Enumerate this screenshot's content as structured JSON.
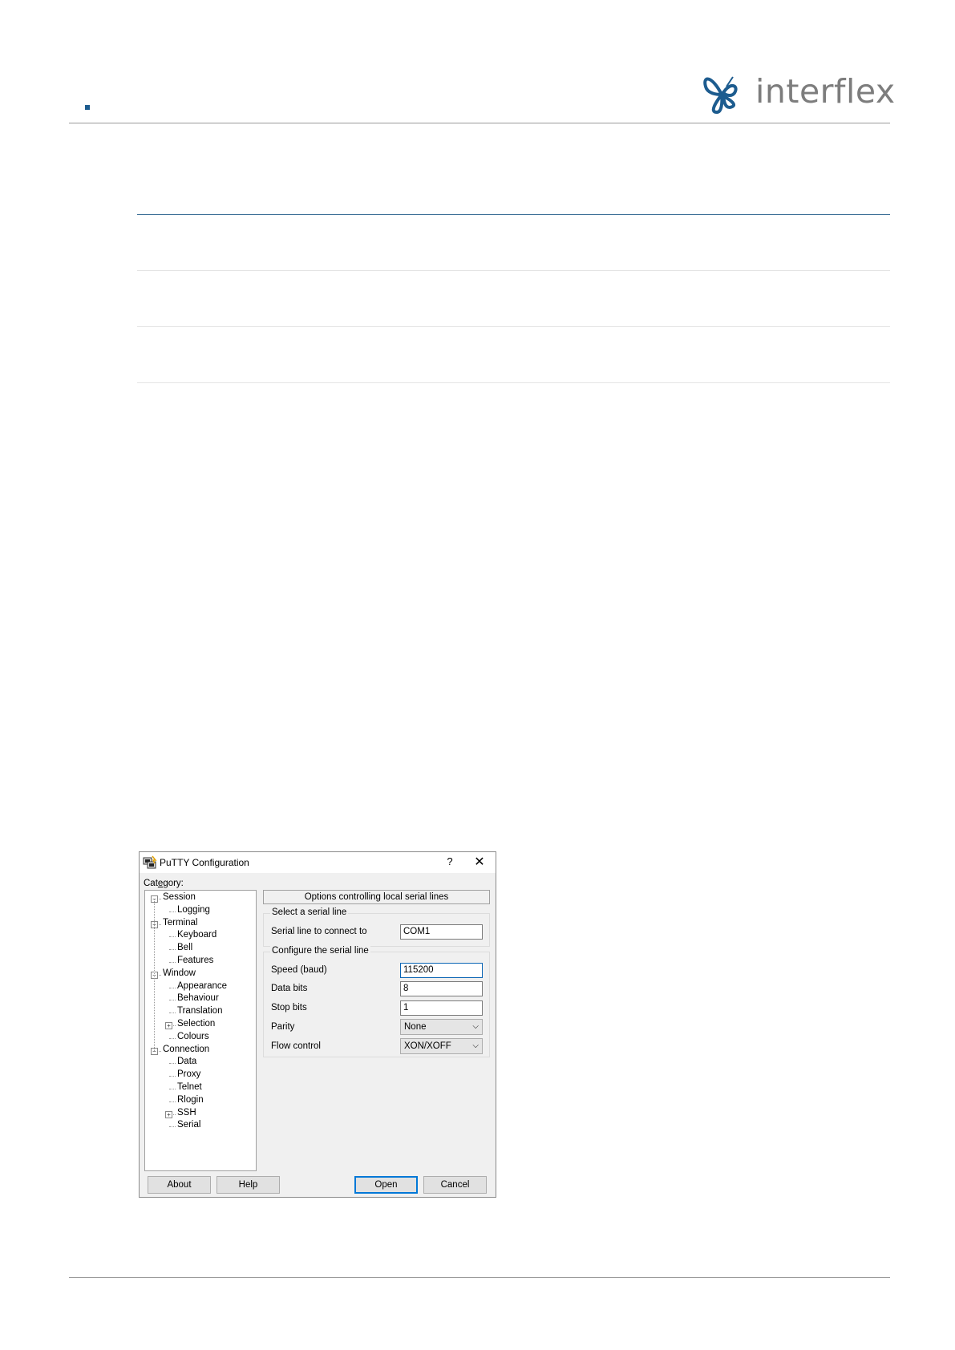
{
  "header": {
    "brand": "interflex"
  },
  "putty": {
    "title": "PuTTY Configuration",
    "help_glyph": "?",
    "close_glyph": "✕",
    "category_label": "Category:",
    "tree": [
      {
        "label": "Session",
        "level": 0,
        "expander": "−"
      },
      {
        "label": "Logging",
        "level": 1
      },
      {
        "label": "Terminal",
        "level": 0,
        "expander": "−"
      },
      {
        "label": "Keyboard",
        "level": 1
      },
      {
        "label": "Bell",
        "level": 1
      },
      {
        "label": "Features",
        "level": 1
      },
      {
        "label": "Window",
        "level": 0,
        "expander": "−"
      },
      {
        "label": "Appearance",
        "level": 1
      },
      {
        "label": "Behaviour",
        "level": 1
      },
      {
        "label": "Translation",
        "level": 1
      },
      {
        "label": "Selection",
        "level": 1,
        "expander": "+"
      },
      {
        "label": "Colours",
        "level": 1
      },
      {
        "label": "Connection",
        "level": 0,
        "expander": "−"
      },
      {
        "label": "Data",
        "level": 1
      },
      {
        "label": "Proxy",
        "level": 1
      },
      {
        "label": "Telnet",
        "level": 1
      },
      {
        "label": "Rlogin",
        "level": 1
      },
      {
        "label": "SSH",
        "level": 1,
        "expander": "+"
      },
      {
        "label": "Serial",
        "level": 1
      }
    ],
    "panel_header": "Options controlling local serial lines",
    "select_group": {
      "title": "Select a serial line",
      "serial_line_label": "Serial line to connect to",
      "serial_line_value": "COM1"
    },
    "config_group": {
      "title": "Configure the serial line",
      "speed_label": "Speed (baud)",
      "speed_value": "115200",
      "data_bits_label": "Data bits",
      "data_bits_value": "8",
      "stop_bits_label": "Stop bits",
      "stop_bits_value": "1",
      "parity_label": "Parity",
      "parity_value": "None",
      "flow_label": "Flow control",
      "flow_value": "XON/XOFF"
    },
    "buttons": {
      "about": "About",
      "help": "Help",
      "open": "Open",
      "cancel": "Cancel"
    }
  }
}
